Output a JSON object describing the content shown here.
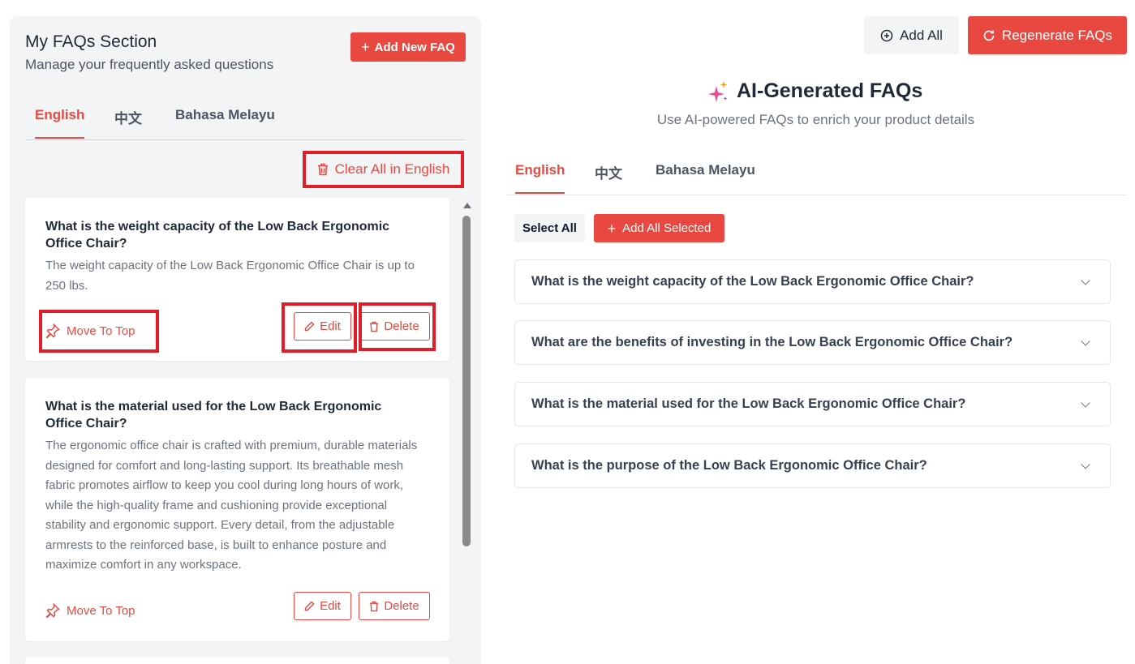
{
  "my_faqs": {
    "title": "My FAQs Section",
    "subtitle": "Manage your frequently asked questions",
    "add_button": "Add New FAQ",
    "tabs": [
      {
        "label": "English",
        "active": true
      },
      {
        "label": "中文",
        "active": false
      },
      {
        "label": "Bahasa Melayu",
        "active": false
      }
    ],
    "clear_all": "Clear All in English",
    "items": [
      {
        "question": "What is the weight capacity of the Low Back Ergonomic Office Chair?",
        "answer": "The weight capacity of the Low Back Ergonomic Office Chair is up to 250 lbs.",
        "move_to_top": "Move To Top",
        "edit": "Edit",
        "delete": "Delete"
      },
      {
        "question": "What is the material used for the Low Back Ergonomic Office Chair?",
        "answer": "The ergonomic office chair is crafted with premium, durable materials designed for comfort and long-lasting support. Its breathable mesh fabric promotes airflow to keep you cool during long hours of work, while the high-quality frame and cushioning provide exceptional stability and ergonomic support. Every detail, from the adjustable armrests to the reinforced base, is built to enhance posture and maximize comfort in any workspace.",
        "move_to_top": "Move To Top",
        "edit": "Edit",
        "delete": "Delete"
      }
    ]
  },
  "toolbar": {
    "add_all": "Add All",
    "regenerate": "Regenerate FAQs"
  },
  "ai_faqs": {
    "title": "AI-Generated FAQs",
    "subtitle": "Use AI-powered FAQs to enrich your product details",
    "tabs": [
      {
        "label": "English",
        "active": true
      },
      {
        "label": "中文",
        "active": false
      },
      {
        "label": "Bahasa Melayu",
        "active": false
      }
    ],
    "select_all": "Select All",
    "add_selected": "Add All Selected",
    "questions": [
      "What is the weight capacity of the Low Back Ergonomic Office Chair?",
      "What are the benefits of investing in the Low Back Ergonomic Office Chair?",
      "What is the material used for the Low Back Ergonomic Office Chair?",
      "What is the purpose of the Low Back Ergonomic Office Chair?"
    ]
  },
  "colors": {
    "accent": "#e8483f",
    "highlight": "#e11d2a",
    "sparkle_primary": "#ec4899",
    "sparkle_secondary": "#f59e0b"
  },
  "icons": {
    "add": "plus-icon",
    "clear": "trash-icon",
    "pin": "pin-icon",
    "edit": "pencil-icon",
    "delete": "trash-icon",
    "add_all": "plus-circle-icon",
    "regenerate": "refresh-icon",
    "ai": "sparkle-icon",
    "expand": "chevron-down-icon"
  }
}
